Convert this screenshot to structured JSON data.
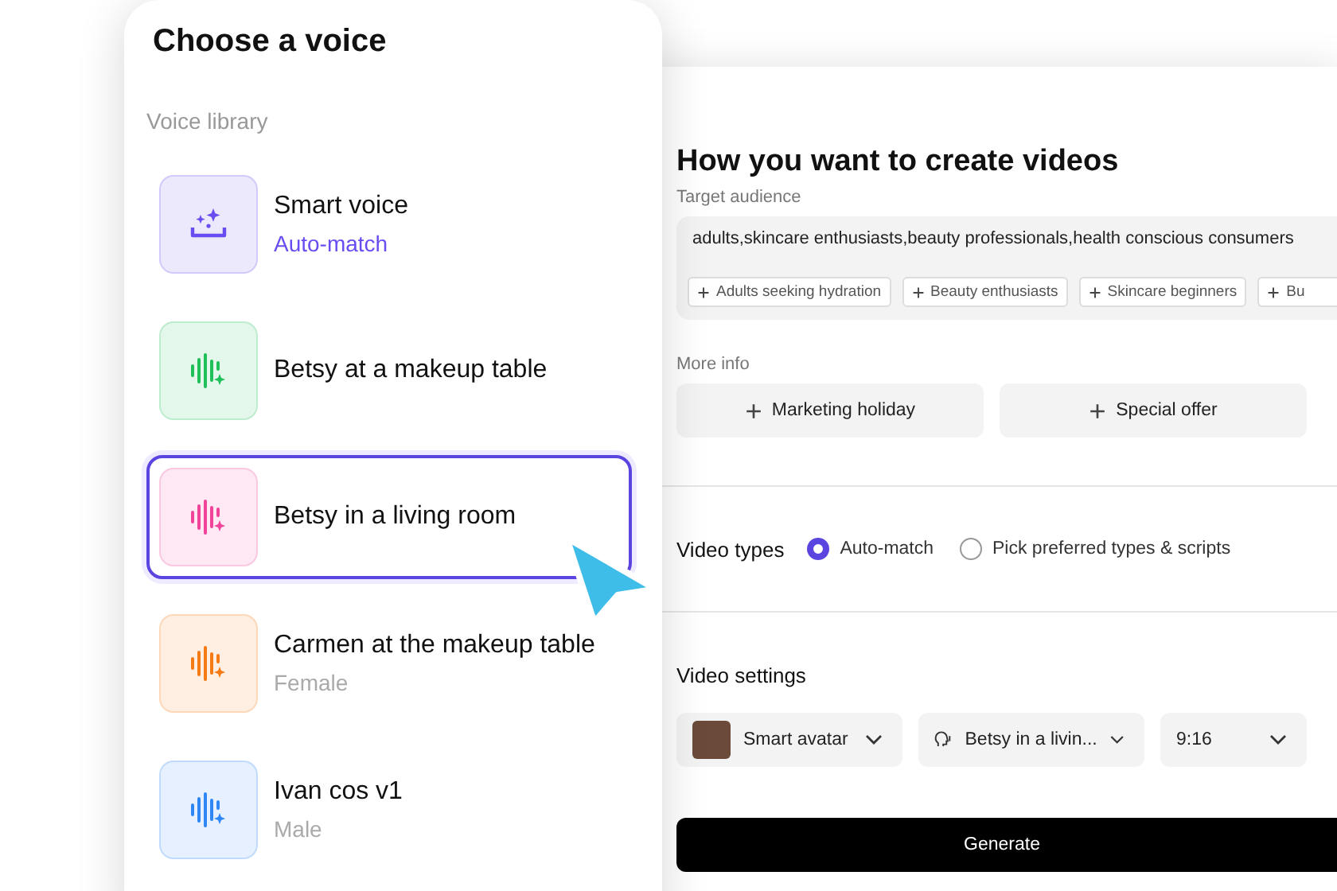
{
  "voice_panel": {
    "title": "Choose a voice",
    "section_label": "Voice library",
    "voices": [
      {
        "name": "Smart voice",
        "subtitle": "Auto-match",
        "kind": "smart",
        "color": "#6a4df0",
        "selected": false
      },
      {
        "name": "Betsy at a makeup table",
        "kind": "wave",
        "color": "#1fbf5a",
        "selected": false
      },
      {
        "name": "Betsy in a living room",
        "kind": "wave",
        "color": "#f0449a",
        "selected": true
      },
      {
        "name": "Carmen at the makeup table",
        "subtitle": "Female",
        "kind": "wave",
        "color": "#f57a14",
        "selected": false
      },
      {
        "name": "Ivan cos v1",
        "subtitle": "Male",
        "kind": "wave",
        "color": "#2f86f5",
        "selected": false
      }
    ]
  },
  "create_panel": {
    "title": "How you want to create videos",
    "target_audience": {
      "label": "Target audience",
      "value": "adults,skincare enthusiasts,beauty professionals,health conscious consumers",
      "suggestions": [
        "Adults seeking hydration",
        "Beauty enthusiasts",
        "Skincare beginners",
        "Bu"
      ]
    },
    "more_info": {
      "label": "More info",
      "buttons": [
        "Marketing holiday",
        "Special offer"
      ]
    },
    "video_types": {
      "label": "Video types",
      "options": [
        {
          "label": "Auto-match",
          "selected": true
        },
        {
          "label": "Pick preferred types & scripts",
          "selected": false
        }
      ]
    },
    "video_settings": {
      "label": "Video settings",
      "dropdowns": [
        {
          "kind": "avatar",
          "value": "Smart avatar"
        },
        {
          "kind": "voice",
          "value": "Betsy in a livin..."
        },
        {
          "kind": "plain",
          "value": "9:16"
        }
      ]
    },
    "generate_button": "Generate"
  }
}
